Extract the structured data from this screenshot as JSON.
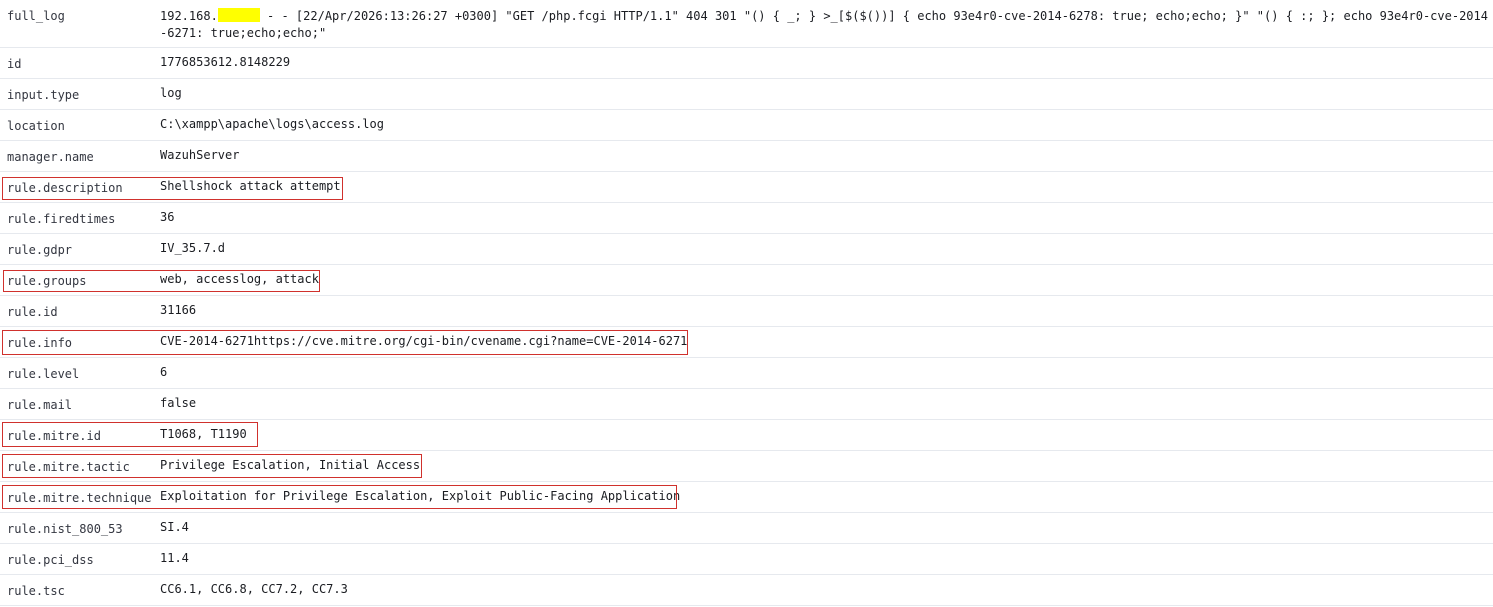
{
  "rows": [
    {
      "field": "full_log",
      "value_prefix": "192.168.",
      "value_rest": " - - [22/Apr/2026:13:26:27 +0300] \"GET /php.fcgi HTTP/1.1\" 404 301 \"() { _; } >_[$($())] { echo 93e4r0-cve-2014-6278: true; echo;echo; }\" \"() { :; }; echo 93e4r0-cve-2014-6271: true;echo;echo;\""
    },
    {
      "field": "id",
      "value": "1776853612.8148229"
    },
    {
      "field": "input.type",
      "value": "log"
    },
    {
      "field": "location",
      "value": "C:\\xampp\\apache\\logs\\access.log"
    },
    {
      "field": "manager.name",
      "value": "WazuhServer"
    },
    {
      "field": "rule.description",
      "value": "Shellshock attack attempt"
    },
    {
      "field": "rule.firedtimes",
      "value": "36"
    },
    {
      "field": "rule.gdpr",
      "value": "IV_35.7.d"
    },
    {
      "field": "rule.groups",
      "value": "web, accesslog, attack"
    },
    {
      "field": "rule.id",
      "value": "31166"
    },
    {
      "field": "rule.info",
      "value": "CVE-2014-6271https://cve.mitre.org/cgi-bin/cvename.cgi?name=CVE-2014-6271"
    },
    {
      "field": "rule.level",
      "value": "6"
    },
    {
      "field": "rule.mail",
      "value": "false"
    },
    {
      "field": "rule.mitre.id",
      "value": "T1068, T1190"
    },
    {
      "field": "rule.mitre.tactic",
      "value": "Privilege Escalation, Initial Access"
    },
    {
      "field": "rule.mitre.technique",
      "value": "Exploitation for Privilege Escalation, Exploit Public-Facing Application"
    },
    {
      "field": "rule.nist_800_53",
      "value": "SI.4"
    },
    {
      "field": "rule.pci_dss",
      "value": "11.4"
    },
    {
      "field": "rule.tsc",
      "value": "CC6.1, CC6.8, CC7.2, CC7.3"
    }
  ],
  "colors": {
    "highlight_border": "#d0312d",
    "redaction": "#ffff00",
    "row_divider": "#e6e9ee"
  }
}
